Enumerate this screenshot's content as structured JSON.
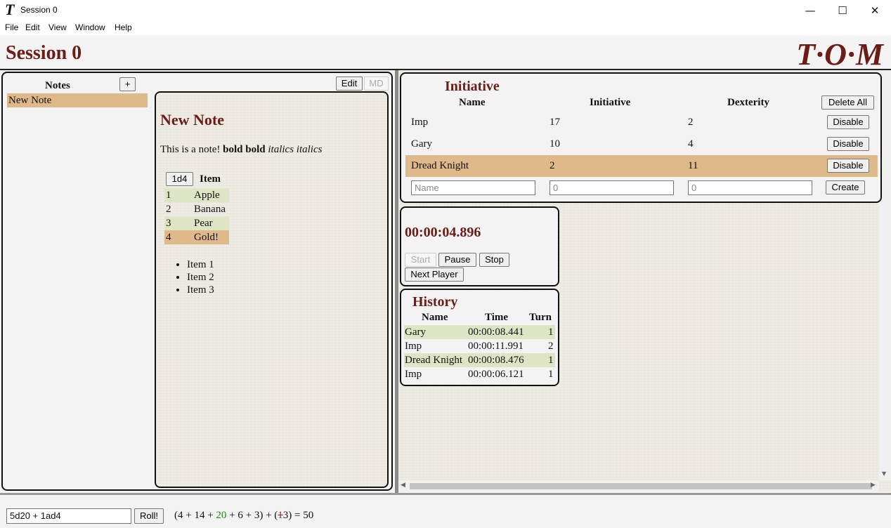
{
  "window": {
    "icon": "T",
    "title": "Session 0",
    "minimize": "—",
    "maximize": "☐",
    "close": "✕"
  },
  "menu": [
    "File",
    "Edit",
    "View",
    "Window",
    "Help"
  ],
  "header": {
    "session_title": "Session 0",
    "logo": "T·O·M"
  },
  "notes": {
    "heading": "Notes",
    "add_label": "+",
    "edit_label": "Edit",
    "md_label": "MD",
    "items": [
      "New Note"
    ],
    "note": {
      "title": "New Note",
      "body_plain": "This is a note! ",
      "body_bold": "bold bold",
      "body_italic": "italics italics",
      "table_button": "1d4",
      "table_header": "Item",
      "table_rows": [
        {
          "num": "1",
          "item": "Apple"
        },
        {
          "num": "2",
          "item": "Banana"
        },
        {
          "num": "3",
          "item": "Pear"
        },
        {
          "num": "4",
          "item": "Gold!"
        }
      ],
      "list": [
        "Item 1",
        "Item 2",
        "Item 3"
      ]
    }
  },
  "initiative": {
    "title": "Initiative",
    "columns": [
      "Name",
      "Initiative",
      "Dexterity"
    ],
    "delete_all_label": "Delete All",
    "rows": [
      {
        "name": "Imp",
        "initiative": "17",
        "dexterity": "2",
        "action": "Disable"
      },
      {
        "name": "Gary",
        "initiative": "10",
        "dexterity": "4",
        "action": "Disable"
      },
      {
        "name": "Dread Knight",
        "initiative": "2",
        "dexterity": "11",
        "action": "Disable"
      }
    ],
    "new_row": {
      "name_placeholder": "Name",
      "initiative_placeholder": "0",
      "dexterity_placeholder": "0",
      "create_label": "Create"
    }
  },
  "timer": {
    "display": "00:00:04.896",
    "start_label": "Start",
    "pause_label": "Pause",
    "stop_label": "Stop",
    "next_label": "Next Player"
  },
  "history": {
    "title": "History",
    "columns": [
      "Name",
      "Time",
      "Turn"
    ],
    "rows": [
      {
        "name": "Gary",
        "time": "00:00:08.441",
        "turn": "1"
      },
      {
        "name": "Imp",
        "time": "00:00:11.991",
        "turn": "2"
      },
      {
        "name": "Dread Knight",
        "time": "00:00:08.476",
        "turn": "1"
      },
      {
        "name": "Imp",
        "time": "00:00:06.121",
        "turn": "1"
      }
    ]
  },
  "dice": {
    "input_value": "5d20 + 1ad4",
    "roll_label": "Roll!",
    "result_a": "(4 + 14 + ",
    "result_b": "20",
    "result_c": " + 6 + 3) + (",
    "result_d": "1",
    "result_e": "3) = 50"
  },
  "colors": {
    "accent": "#6b1c16",
    "highlight": "#e0b98a",
    "stripe": "#dde5c4",
    "selected_row": "#e0b98a"
  }
}
